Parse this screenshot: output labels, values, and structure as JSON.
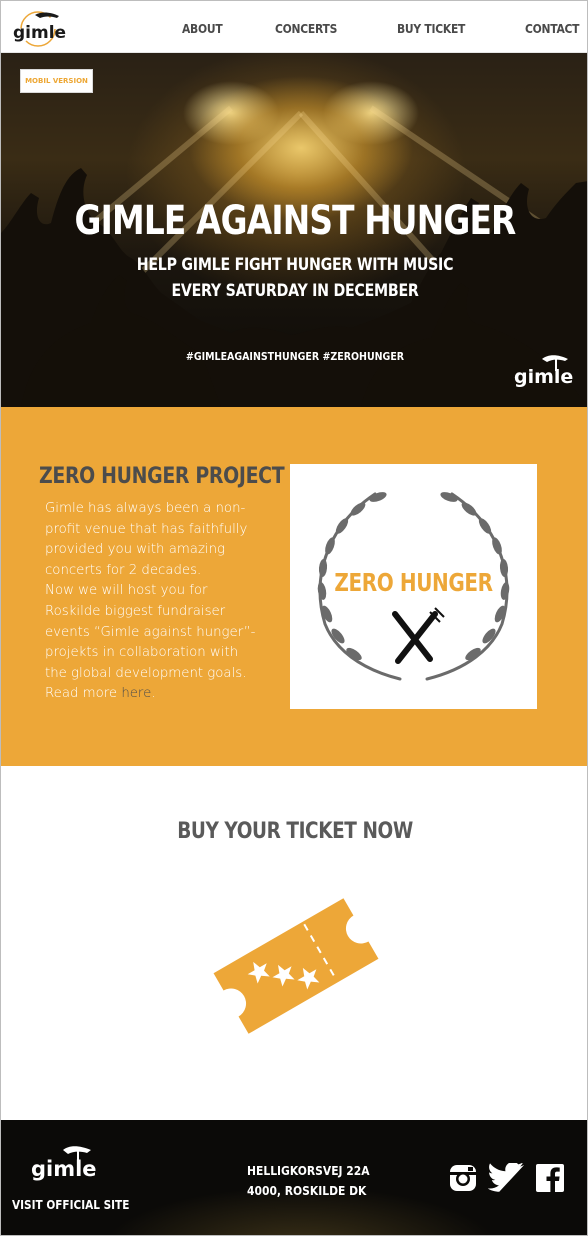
{
  "nav": {
    "logo_text": "gimle",
    "items": [
      {
        "label": "ABOUT"
      },
      {
        "label": "CONCERTS"
      },
      {
        "label": "BUY TICKET"
      },
      {
        "label": "CONTACT"
      }
    ]
  },
  "hero": {
    "badge": "MOBIL VERSION",
    "title": "GIMLE AGAINST HUNGER",
    "subtitle_line1": "HELP GIMLE FIGHT HUNGER WITH MUSIC",
    "subtitle_line2": "EVERY SATURDAY IN DECEMBER",
    "hashtags": "#GIMLEAGAINSTHUNGER #ZEROHUNGER",
    "logo_text": "gimle"
  },
  "zero_hunger": {
    "heading": "ZERO HUNGER PROJECT",
    "lines": [
      "Gimle has always been a non-",
      "profit venue that has faithfully",
      "provided you with amazing",
      "concerts for 2 decades.",
      "Now we will host you for",
      "Roskilde biggest fundraiser",
      "events “Gimle against hunger”-",
      "projekts in collaboration with",
      "the global development goals."
    ],
    "read_more_prefix": "Read more ",
    "read_more_link": "here",
    "read_more_suffix": ".",
    "card_title": "ZERO HUNGER"
  },
  "ticket": {
    "heading": "BUY YOUR TICKET NOW"
  },
  "footer": {
    "logo_text": "gimle",
    "visit": "VISIT OFFICIAL SITE",
    "address_line1": "HELLIGKORSVEJ 22A",
    "address_line2": "4000, ROSKILDE DK",
    "social": [
      "instagram-icon",
      "twitter-icon",
      "facebook-icon"
    ]
  },
  "colors": {
    "accent": "#eda738",
    "dark_text": "#4c4c4c",
    "footer_bg": "#0b0a08"
  }
}
